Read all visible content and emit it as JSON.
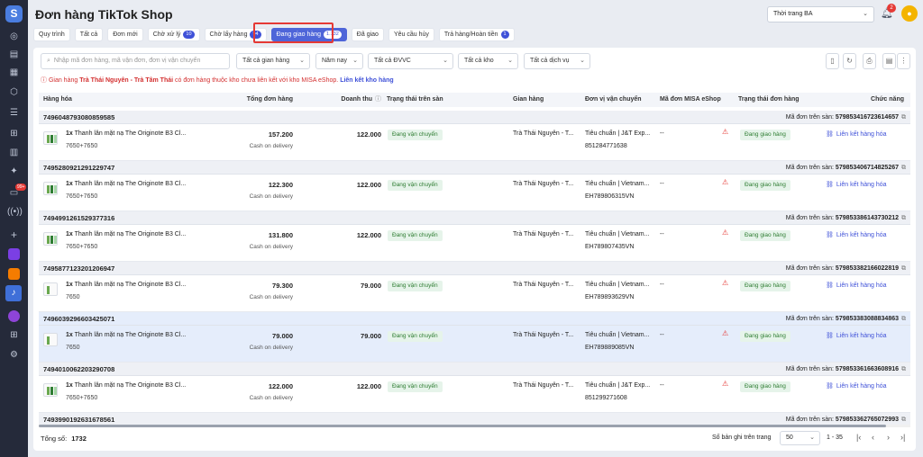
{
  "sidebar": {
    "logo": "S",
    "badge": "99+"
  },
  "header": {
    "title": "Đơn hàng TikTok Shop",
    "shop": "Thời trang BA",
    "notif_count": "2"
  },
  "tabs": [
    {
      "label": "Quy trình",
      "count": ""
    },
    {
      "label": "Tất cả",
      "count": ""
    },
    {
      "label": "Đơn mới",
      "count": ""
    },
    {
      "label": "Chờ xử lý",
      "count": "10"
    },
    {
      "label": "Chờ lấy hàng",
      "count": "94"
    },
    {
      "label": "Đang giao hàng",
      "count": "1.732"
    },
    {
      "label": "Đã giao",
      "count": ""
    },
    {
      "label": "Yêu cầu hủy",
      "count": ""
    },
    {
      "label": "Trả hàng/Hoàn tiền",
      "count": "1"
    }
  ],
  "filters": {
    "search_placeholder": "Nhập mã đơn hàng, mã vận đơn, đơn vị vận chuyển",
    "stall": "Tất cả gian hàng",
    "year": "Năm nay",
    "carrier": "Tất cả ĐVVC",
    "warehouse": "Tất cả kho",
    "service": "Tất cả dịch vụ"
  },
  "notice": {
    "prefix": "Gian hàng",
    "shop": "Trà Thái Nguyên - Trà Tâm Thái",
    "suffix": "có đơn hàng thuộc kho chưa liên kết với kho MISA eShop.",
    "link": "Liên kết kho hàng"
  },
  "table": {
    "headers": [
      "Hàng hóa",
      "Tổng đơn hàng",
      "Doanh thu",
      "Trạng thái trên sàn",
      "Gian hàng",
      "Đơn vị vận chuyển",
      "Mã đơn MISA eShop",
      "Trạng thái đơn hàng",
      "Chức năng"
    ],
    "ext_label": "Mã đơn trên sàn:",
    "orders": [
      {
        "id": "7496048793080859585",
        "ext": "579853416723614657",
        "qty": "1x",
        "product": "Thanh lăn mặt nạ The Originote B3 Cl...",
        "sku": "7650+7650",
        "total": "157.200",
        "payment": "Cash on delivery",
        "revenue": "122.000",
        "platform_status": "Đang vận chuyển",
        "stall": "Trà Thái Nguyên - T...",
        "carrier": "Tiêu chuẩn | J&T Exp...",
        "tracking": "851284771638",
        "misa": "--",
        "status": "Đang giao hàng",
        "action": "Liên kết hàng hóa"
      },
      {
        "id": "7495280921291229747",
        "ext": "579853406714825267",
        "qty": "1x",
        "product": "Thanh lăn mặt nạ The Originote B3 Cl...",
        "sku": "7650+7650",
        "total": "122.300",
        "payment": "Cash on delivery",
        "revenue": "122.000",
        "platform_status": "Đang vận chuyển",
        "stall": "Trà Thái Nguyên - T...",
        "carrier": "Tiêu chuẩn | Vietnam...",
        "tracking": "EH789806315VN",
        "misa": "--",
        "status": "Đang giao hàng",
        "action": "Liên kết hàng hóa"
      },
      {
        "id": "7494991261529377316",
        "ext": "579853386143730212",
        "qty": "1x",
        "product": "Thanh lăn mặt nạ The Originote B3 Cl...",
        "sku": "7650+7650",
        "total": "131.800",
        "payment": "Cash on delivery",
        "revenue": "122.000",
        "platform_status": "Đang vận chuyển",
        "stall": "Trà Thái Nguyên - T...",
        "carrier": "Tiêu chuẩn | Vietnam...",
        "tracking": "EH789807435VN",
        "misa": "--",
        "status": "Đang giao hàng",
        "action": "Liên kết hàng hóa"
      },
      {
        "id": "7495877123201206947",
        "ext": "579853382166022819",
        "qty": "1x",
        "product": "Thanh lăn mặt nạ The Originote B3 Cl...",
        "sku": "7650",
        "total": "79.300",
        "payment": "Cash on delivery",
        "revenue": "79.000",
        "platform_status": "Đang vận chuyển",
        "stall": "Trà Thái Nguyên - T...",
        "carrier": "Tiêu chuẩn | Vietnam...",
        "tracking": "EH789893629VN",
        "misa": "--",
        "status": "Đang giao hàng",
        "action": "Liên kết hàng hóa"
      },
      {
        "id": "7496039296603425071",
        "ext": "579853383088834863",
        "qty": "1x",
        "product": "Thanh lăn mặt nạ The Originote B3 Cl...",
        "sku": "7650",
        "total": "79.000",
        "payment": "Cash on delivery",
        "revenue": "79.000",
        "platform_status": "Đang vận chuyển",
        "stall": "Trà Thái Nguyên - T...",
        "carrier": "Tiêu chuẩn | Vietnam...",
        "tracking": "EH789889085VN",
        "misa": "--",
        "status": "Đang giao hàng",
        "action": "Liên kết hàng hóa"
      },
      {
        "id": "7494010062203290708",
        "ext": "579853361663608916",
        "qty": "1x",
        "product": "Thanh lăn mặt nạ The Originote B3 Cl...",
        "sku": "7650+7650",
        "total": "122.000",
        "payment": "Cash on delivery",
        "revenue": "122.000",
        "platform_status": "Đang vận chuyển",
        "stall": "Trà Thái Nguyên - T...",
        "carrier": "Tiêu chuẩn | J&T Exp...",
        "tracking": "851299271608",
        "misa": "--",
        "status": "Đang giao hàng",
        "action": "Liên kết hàng hóa"
      },
      {
        "id": "7493990192631678561",
        "ext": "579853362765072993"
      }
    ]
  },
  "footer": {
    "total_label": "Tổng số:",
    "total": "1732",
    "per_page_label": "Số bản ghi trên trang",
    "per_page": "50",
    "range": "1 - 35"
  }
}
